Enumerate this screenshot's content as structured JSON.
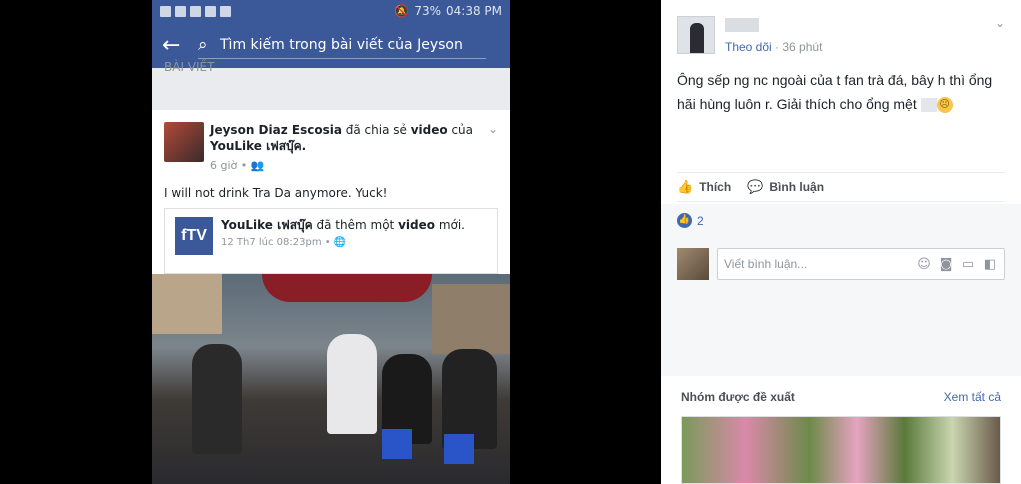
{
  "phone": {
    "status_battery": "73%",
    "status_time": "04:38 PM",
    "search_placeholder": "Tìm kiếm trong bài viết của Jeyson",
    "section_label": "BÀI VIẾT",
    "post": {
      "author": "Jeyson Diaz Escosia",
      "action_prefix": "đã chia sẻ",
      "action_object": "video",
      "action_suffix": "của",
      "page_name": "YouLike เฟสบุ๊ค.",
      "time": "6 giờ",
      "text": "I will not drink Tra Da anymore. Yuck!",
      "shared": {
        "logo_text": "fTV",
        "page_name": "YouLike เฟสบุ๊ค",
        "action_prefix": "đã thêm một",
        "action_object": "video",
        "action_suffix": "mới.",
        "time": "12 Th7 lúc 08:23pm"
      }
    }
  },
  "panel": {
    "follow_label": "Theo dõi",
    "time_ago": "36 phút",
    "caption": "Ông sếp ng nc ngoài của t fan trà đá, bây h thì ổng hãi hùng luôn r. Giải thích cho ổng mệt",
    "like_label": "Thích",
    "comment_label": "Bình luận",
    "like_count": "2",
    "comment_placeholder": "Viết bình luận...",
    "suggest_title": "Nhóm được đề xuất",
    "see_all": "Xem tất cả",
    "colors": {
      "facebook_blue": "#3b5998",
      "link_blue": "#4267b2"
    },
    "icons": [
      "like-icon",
      "comment-icon",
      "emoji-icon",
      "camera-icon",
      "gif-icon",
      "sticker-icon"
    ]
  }
}
